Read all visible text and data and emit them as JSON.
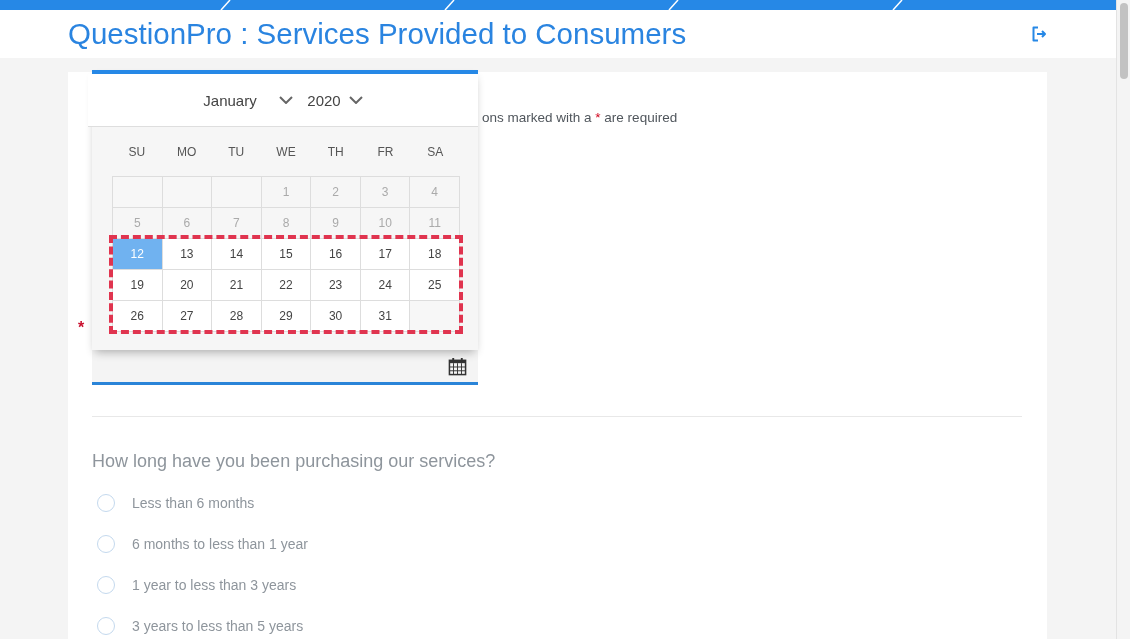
{
  "header": {
    "title": "QuestionPro : Services Provided to Consumers"
  },
  "required_note": {
    "text_before": "ons marked with a",
    "mark": "*",
    "text_after": "are required"
  },
  "date_question": {
    "required_mark": "*"
  },
  "datepicker": {
    "month": "January",
    "year": "2020",
    "weekdays": [
      "SU",
      "MO",
      "TU",
      "WE",
      "TH",
      "FR",
      "SA"
    ],
    "weeks": [
      {
        "highlighted": false,
        "days": [
          {
            "kind": "empty"
          },
          {
            "kind": "empty"
          },
          {
            "kind": "empty"
          },
          {
            "kind": "date",
            "label": "1",
            "disabled": true,
            "selected": false
          },
          {
            "kind": "date",
            "label": "2",
            "disabled": true,
            "selected": false
          },
          {
            "kind": "date",
            "label": "3",
            "disabled": true,
            "selected": false
          },
          {
            "kind": "date",
            "label": "4",
            "disabled": true,
            "selected": false
          }
        ]
      },
      {
        "highlighted": false,
        "days": [
          {
            "kind": "date",
            "label": "5",
            "disabled": true,
            "selected": false
          },
          {
            "kind": "date",
            "label": "6",
            "disabled": true,
            "selected": false
          },
          {
            "kind": "date",
            "label": "7",
            "disabled": true,
            "selected": false
          },
          {
            "kind": "date",
            "label": "8",
            "disabled": true,
            "selected": false
          },
          {
            "kind": "date",
            "label": "9",
            "disabled": true,
            "selected": false
          },
          {
            "kind": "date",
            "label": "10",
            "disabled": true,
            "selected": false
          },
          {
            "kind": "date",
            "label": "11",
            "disabled": true,
            "selected": false
          }
        ]
      },
      {
        "highlighted": true,
        "days": [
          {
            "kind": "date",
            "label": "12",
            "disabled": false,
            "selected": true
          },
          {
            "kind": "date",
            "label": "13",
            "disabled": false,
            "selected": false
          },
          {
            "kind": "date",
            "label": "14",
            "disabled": false,
            "selected": false
          },
          {
            "kind": "date",
            "label": "15",
            "disabled": false,
            "selected": false
          },
          {
            "kind": "date",
            "label": "16",
            "disabled": false,
            "selected": false
          },
          {
            "kind": "date",
            "label": "17",
            "disabled": false,
            "selected": false
          },
          {
            "kind": "date",
            "label": "18",
            "disabled": false,
            "selected": false
          }
        ]
      },
      {
        "highlighted": true,
        "days": [
          {
            "kind": "date",
            "label": "19",
            "disabled": false,
            "selected": false
          },
          {
            "kind": "date",
            "label": "20",
            "disabled": false,
            "selected": false
          },
          {
            "kind": "date",
            "label": "21",
            "disabled": false,
            "selected": false
          },
          {
            "kind": "date",
            "label": "22",
            "disabled": false,
            "selected": false
          },
          {
            "kind": "date",
            "label": "23",
            "disabled": false,
            "selected": false
          },
          {
            "kind": "date",
            "label": "24",
            "disabled": false,
            "selected": false
          },
          {
            "kind": "date",
            "label": "25",
            "disabled": false,
            "selected": false
          }
        ]
      },
      {
        "highlighted": true,
        "days": [
          {
            "kind": "date",
            "label": "26",
            "disabled": false,
            "selected": false
          },
          {
            "kind": "date",
            "label": "27",
            "disabled": false,
            "selected": false
          },
          {
            "kind": "date",
            "label": "28",
            "disabled": false,
            "selected": false
          },
          {
            "kind": "date",
            "label": "29",
            "disabled": false,
            "selected": false
          },
          {
            "kind": "date",
            "label": "30",
            "disabled": false,
            "selected": false
          },
          {
            "kind": "date",
            "label": "31",
            "disabled": false,
            "selected": false
          },
          {
            "kind": "empty"
          }
        ]
      }
    ]
  },
  "question": {
    "text": "How long have you been purchasing our services?",
    "dimmed": true,
    "options": [
      {
        "label": "Less than 6 months",
        "selected": false
      },
      {
        "label": "6 months to less than 1 year",
        "selected": false
      },
      {
        "label": "1 year to less than 3 years",
        "selected": false
      },
      {
        "label": "3 years to less than 5 years",
        "selected": false
      }
    ]
  }
}
